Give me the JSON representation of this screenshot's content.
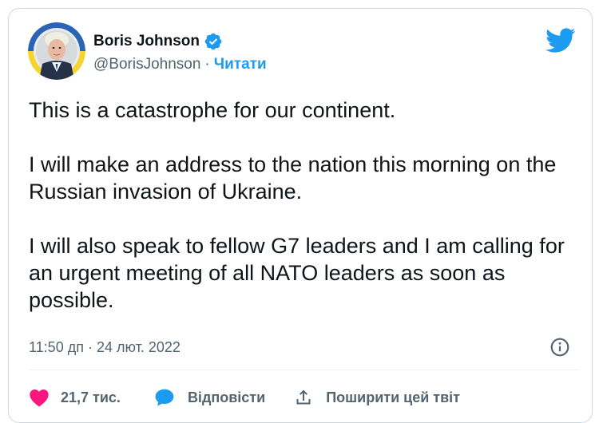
{
  "author": {
    "name": "Boris Johnson",
    "handle": "@BorisJohnson",
    "separator": "·",
    "follow_label": "Читати",
    "verified": true
  },
  "tweet": {
    "paragraphs": [
      "This is a catastrophe for our continent.",
      "I will make an address to the nation this morning on the Russian invasion of Ukraine.",
      "I will also speak to fellow G7 leaders and I am calling for an urgent meeting of all NATO leaders as soon as possible."
    ],
    "time": "11:50 дп",
    "date_separator": "·",
    "date": "24 лют. 2022"
  },
  "actions": {
    "like_count": "21,7 тис.",
    "reply_label": "Відповісти",
    "share_label": "Поширити цей твіт"
  },
  "colors": {
    "brand_blue": "#1d9bf0",
    "like_red": "#f91880",
    "text": "#0f1419",
    "muted": "#536471",
    "border": "#cfd9de"
  },
  "icons": {
    "logo": "twitter-bird-icon",
    "verified": "verified-badge-icon",
    "info": "info-icon",
    "like": "heart-icon",
    "reply": "speech-bubble-icon",
    "share": "share-icon"
  }
}
